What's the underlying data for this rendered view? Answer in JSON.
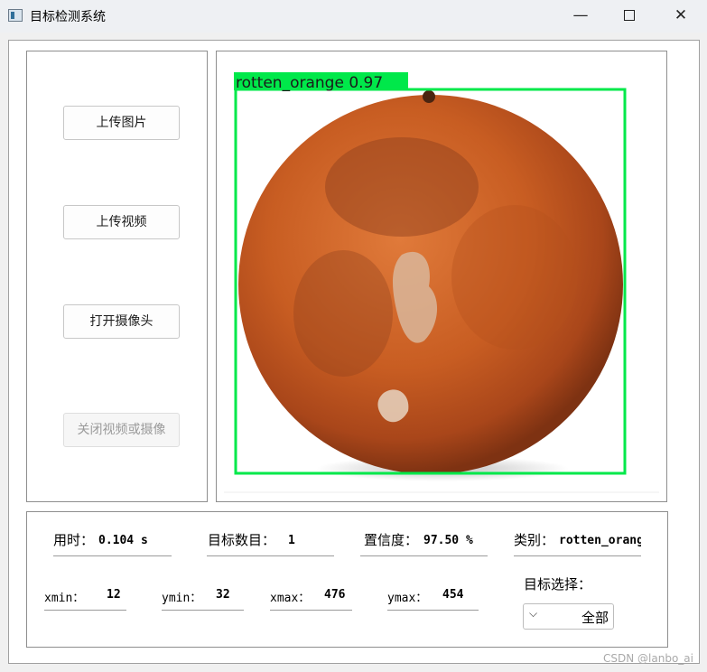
{
  "window": {
    "title": "目标检测系统",
    "controls": [
      "—",
      "✕"
    ]
  },
  "buttons": {
    "upload_image": "上传图片",
    "upload_video": "上传视频",
    "open_camera": "打开摄像头",
    "close_video_camera": "关闭视频或摄像"
  },
  "detection": {
    "label": "rotten_orange 0.97",
    "box_color": "#00e84a"
  },
  "stats": {
    "time_label": "用时：",
    "time_value": "0.104 s",
    "count_label": "目标数目：",
    "count_value": "1",
    "confidence_label": "置信度：",
    "confidence_value": "97.50 %",
    "class_label": "类别：",
    "class_value": "rotten_orange"
  },
  "coords": {
    "xmin_label": "xmin：",
    "xmin_value": "12",
    "ymin_label": "ymin：",
    "ymin_value": "32",
    "xmax_label": "xmax：",
    "xmax_value": "476",
    "ymax_label": "ymax：",
    "ymax_value": "454"
  },
  "target_select": {
    "label": "目标选择：",
    "value": "全部"
  },
  "watermark": "CSDN @lanbo_ai"
}
